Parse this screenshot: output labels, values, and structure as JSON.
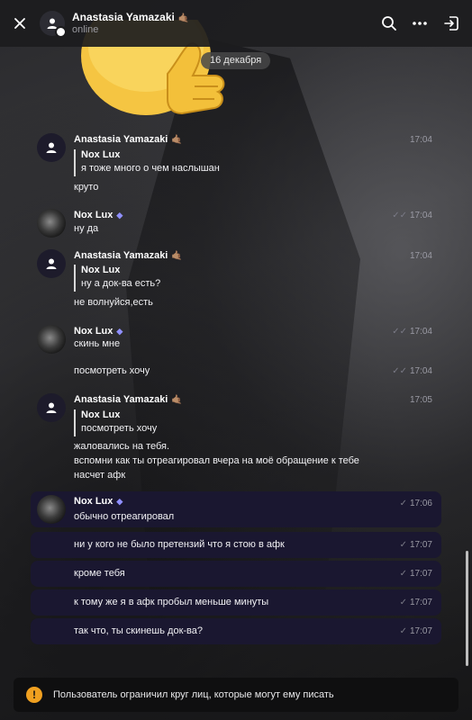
{
  "header": {
    "name": "Anastasia Yamazaki",
    "status": "online",
    "name_emoji": "🤙🏽"
  },
  "date_separator": "16 декабря",
  "messages": [
    {
      "author": "Anastasia Yamazaki",
      "time": "17:04",
      "quote_author": "Nox Lux",
      "quote_text": "я тоже много о чем наслышан",
      "text": "круто"
    },
    {
      "author": "Nox Lux",
      "time": "17:04",
      "text": "ну да"
    },
    {
      "author": "Anastasia Yamazaki",
      "time": "17:04",
      "quote_author": "Nox Lux",
      "quote_text": "ну а док-ва есть?",
      "text": "не волнуйся,есть"
    },
    {
      "author": "Nox Lux",
      "time": "17:04",
      "text": "скинь мне"
    },
    {
      "time": "17:04",
      "text": "посмотреть хочу"
    },
    {
      "author": "Anastasia Yamazaki",
      "time": "17:05",
      "quote_author": "Nox Lux",
      "quote_text": "посмотреть хочу",
      "text_lines": [
        "жаловались на тебя.",
        "вспомни как ты отреагировал вчера на моё обращение к тебе",
        "насчет афк"
      ]
    },
    {
      "author": "Nox Lux",
      "time": "17:06",
      "text": "обычно отреагировал"
    },
    {
      "time": "17:07",
      "text": "ни у кого не было претензий что я стою в афк"
    },
    {
      "time": "17:07",
      "text": "кроме тебя"
    },
    {
      "time": "17:07",
      "text": "к тому же я в афк пробыл меньше минуты"
    },
    {
      "time": "17:07",
      "text": "так что, ты скинешь док-ва?"
    }
  ],
  "notice": {
    "text": "Пользователь ограничил круг лиц, которые могут ему писать"
  },
  "icons": {
    "close": "close-icon",
    "search": "search-icon",
    "more": "more-icon",
    "exit": "exit-icon",
    "warning": "warning-icon"
  },
  "colors": {
    "own_bubble": "#1a1730",
    "warning": "#f0a020"
  }
}
